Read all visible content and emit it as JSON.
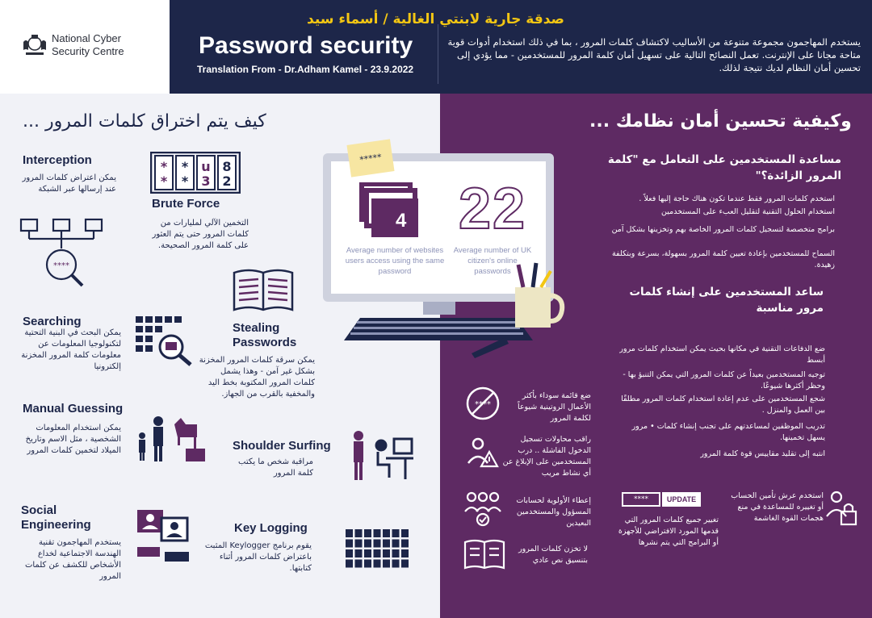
{
  "header": {
    "org_line1": "National Cyber",
    "org_line2": "Security Centre",
    "dedication": "صدقة جارية لابنتي الغالية / أسماء سيد",
    "title": "Password security",
    "translation": "Translation From - Dr.Adham Kamel - 23.9.2022",
    "intro": "يستخدم المهاجمون مجموعة متنوعة من الأساليب لاكتشاف كلمات المرور ، بما في ذلك استخدام أدوات قوية متاحة مجانا على الإنترنت. تعمل النصائح التالية على تسهيل أمان كلمة المرور للمستخدمين - مما يؤدي إلى تحسين أمان النظام لديك نتيجة لذلك."
  },
  "left": {
    "heading": "كيف يتم اختراق كلمات المرور ...",
    "items": [
      {
        "title": "Interception",
        "desc": "يمكن اعتراض كلمات المرور عند إرسالها عبر الشبكة"
      },
      {
        "title": "Brute Force",
        "desc": "التخمين الآلي لمليارات من كلمات المرور حتى يتم العثور على كلمة المرور الصحيحة."
      },
      {
        "title": "Searching",
        "desc": "يمكن البحث في البنية التحتية لتكنولوجيا المعلومات عن معلومات كلمة المرور المخزنة إلكترونيا"
      },
      {
        "title": "Stealing Passwords",
        "title2": "Passwords",
        "title1": "Stealing",
        "desc": "يمكن سرقة كلمات المرور المخزنة بشكل غير آمن - وهذا يشمل كلمات المرور المكتوبة بخط اليد والمخفية بالقرب من الجهاز."
      },
      {
        "title": "Manual Guessing",
        "desc": "يمكن استخدام المعلومات الشخصية ، مثل الاسم وتاريخ الميلاد لتخمين كلمات المرور"
      },
      {
        "title": "Shoulder Surfing",
        "desc": "مراقبة شخص ما يكتب كلمة المرور"
      },
      {
        "title1": "Social",
        "title2": "Engineering",
        "desc": "يستخدم المهاجمون تقنية الهندسة الاجتماعية لخداع الأشخاص للكشف عن كلمات المرور"
      },
      {
        "title": "Key Logging",
        "desc": "يقوم برنامج Keylogger المثبت باعتراض كلمات المرور أثناء كتابتها."
      }
    ],
    "brute_force_chars": [
      "*",
      "*",
      "u",
      "8",
      "*",
      "*",
      "3",
      "2"
    ]
  },
  "monitor": {
    "stat1_value": "4",
    "stat1_caption": "Average number of websites users access using the same password",
    "stat2_value": "22",
    "stat2_caption": "Average number of UK citizen's online passwords",
    "sticky_note": "*****"
  },
  "right": {
    "heading": "وكيفية تحسين أمان نظامك ...",
    "sub1": "مساعدة المستخدمين على التعامل مع \"كلمة المرور الزائدة؟\"",
    "sub1_points": [
      "استخدم كلمات المرور فقط عندما تكون هناك حاجة إليها فعلاً .",
      "استخدام الحلول التقنية لتقليل العبء على المستخدمين",
      "برامج متخصصة لتسجيل كلمات المرور الخاصة بهم وتخزينها بشكل آمن",
      "السماح للمستخدمين بإعادة تعيين كلمة المرور بسهولة، بسرعة وبتكلفة زهيدة."
    ],
    "sub2": "ساعد المستخدمين على إنشاء كلمات مرور مناسبة",
    "sub2_points": [
      "ضع الدفاعات التقنية في مكانها بحيث يمكن استخدام كلمات مرور أبسط",
      "توجيه المستخدمين بعيداً عن كلمات المرور التي يمكن التنبؤ بها - وحظر أكثرها شيوعًا.",
      "شجع المستخدمين على عدم إعادة استخدام كلمات المرور مطلقًا بين العمل والمنزل .",
      "تدريب الموظفين لمساعدتهم على تجنب إنشاء كلمات • مرور يسهل تخمينها.",
      "انتبه إلى تقليد مقاييس قوة كلمة المرور"
    ],
    "tips": [
      "ضع قائمة سوداء بأكثر الأعمال الروتينية شيوعاً لكلمة المرور",
      "راقب محاولات تسجيل الدخول الفاشلة .. درب المستخدمين على الإبلاغ عن أي نشاط مريب",
      "إعطاء الأولوية لحسابات المسؤول والمستخدمين البعيدين",
      "تغيير جميع كلمات المرور التي قدمها المورد الافتراضي للأجهزة أو البرامج التي يتم نشرها",
      "استخدم عرش تأمين الحساب أو تغييره للمساعدة في منع هجمات القوة الغاشمة",
      "لا تخزن كلمات المرور بتنسيق نص عادي"
    ],
    "update_label": "UPDATE",
    "update_stars": "****"
  },
  "colors": {
    "navy": "#1d2649",
    "purple": "#5e2a63",
    "accent_yellow": "#f3c613",
    "light_bg": "#f1f2f7"
  }
}
